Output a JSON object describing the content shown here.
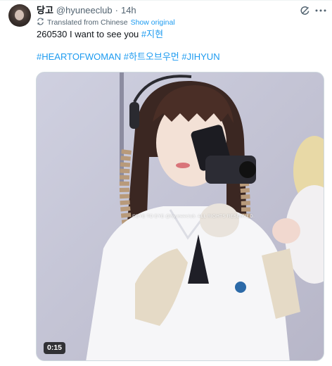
{
  "tweet": {
    "display_name": "당고",
    "handle": "@hyuneeclub",
    "separator": "·",
    "timestamp": "14h",
    "translation_label": "Translated from Chinese",
    "show_original_label": "Show original",
    "text": "260530 I want to see you",
    "hashtags_line1": [
      "#지현"
    ],
    "hashtags_line2": [
      "#HEARTOFWOMAN",
      "#하트오브우먼",
      "#JIHYUN"
    ]
  },
  "media": {
    "type": "video",
    "duration": "0:15",
    "watermark": "©EYE TO EYE @hyuneeclub. ALL RIGHTS RESERVED."
  },
  "icons": {
    "grok": "grok-icon",
    "more": "more-options-icon",
    "translate": "translate-icon"
  },
  "colors": {
    "link": "#1d9bf0",
    "secondary_text": "#536471",
    "primary_text": "#0f1419"
  }
}
